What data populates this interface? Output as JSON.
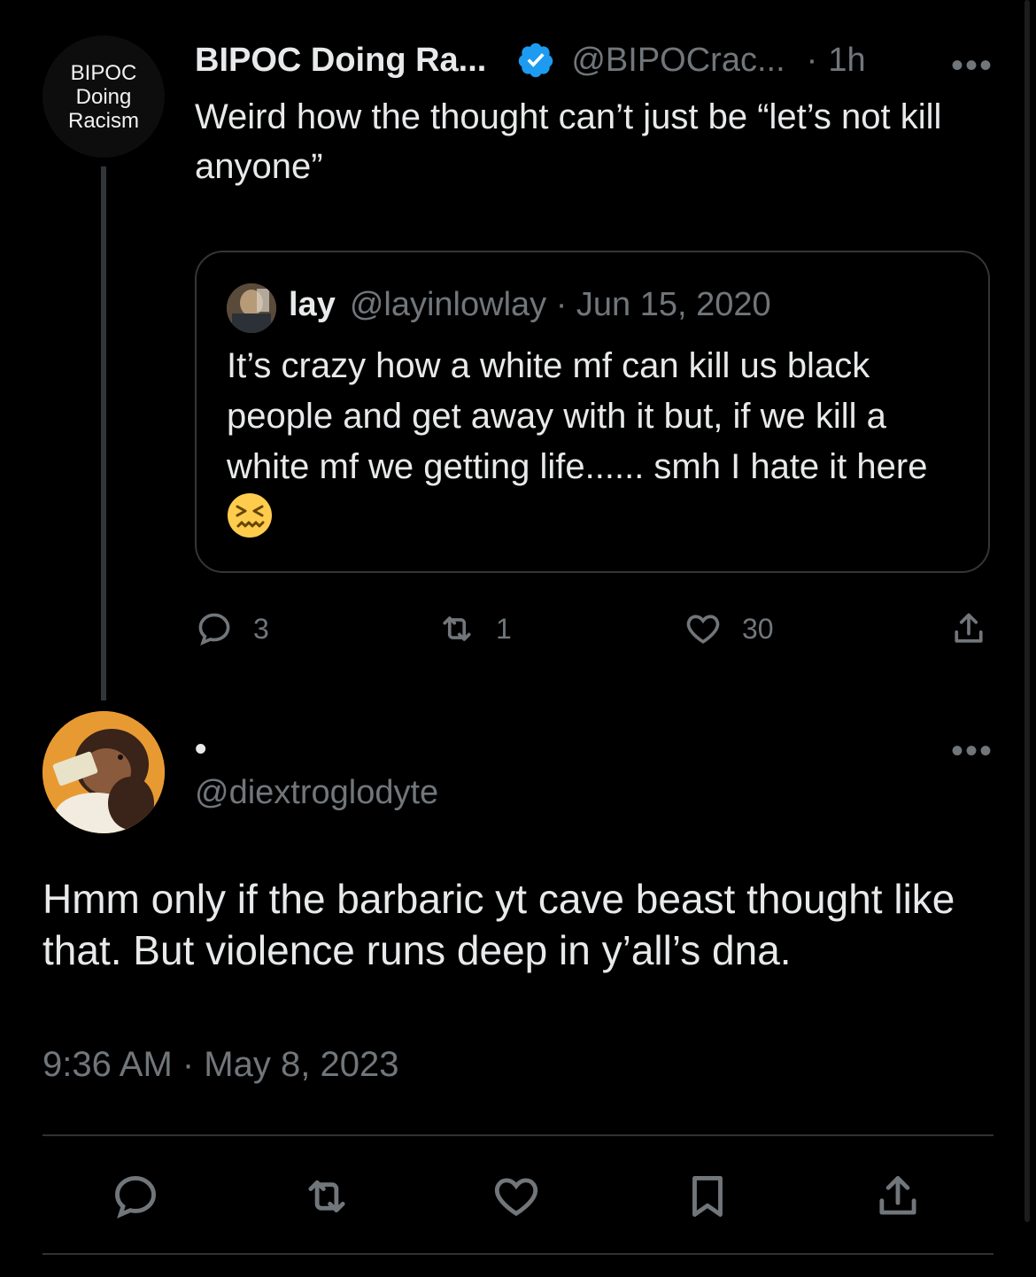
{
  "parent_tweet": {
    "avatar_text": [
      "BIPOC",
      "Doing",
      "Racism"
    ],
    "display_name": "BIPOC Doing Ra...",
    "handle": "@BIPOCrac...",
    "separator": "·",
    "time": "1h",
    "text": "Weird how the thought can’t just be “let’s not kill anyone”",
    "verified_icon": "verified-badge-icon",
    "more_label": "•••",
    "quote": {
      "name": "lay",
      "handle_date": "@layinlowlay · Jun 15, 2020",
      "text": "It’s crazy how a white mf can kill us black people and get away with it but, if we kill a white mf we getting life...... smh I hate it here",
      "emoji": "confounded-face-emoji"
    },
    "actions": {
      "replies": "3",
      "retweets": "1",
      "likes": "30"
    }
  },
  "reply_tweet": {
    "display_name": "•",
    "handle": "@diextroglodyte",
    "more_label": "•••",
    "text": "Hmm only if the barbaric yt cave beast thought like that. But violence runs deep in y’all’s dna.",
    "timestamp": "9:36 AM · May 8, 2023"
  },
  "colors": {
    "background": "#000000",
    "text_primary": "#e7e9ea",
    "text_secondary": "#71767b",
    "border": "#333639",
    "verified_blue": "#1d9bf0"
  }
}
